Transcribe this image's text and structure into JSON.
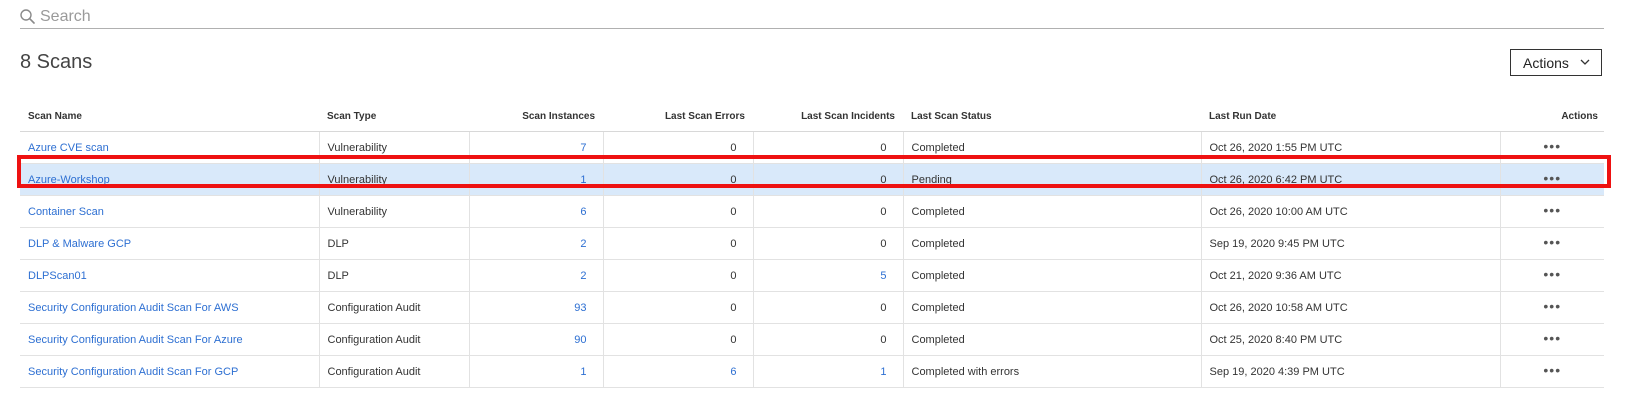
{
  "search": {
    "placeholder": "Search"
  },
  "header": {
    "count_title": "8 Scans",
    "actions_label": "Actions"
  },
  "table": {
    "columns": [
      "Scan Name",
      "Scan Type",
      "Scan Instances",
      "Last Scan Errors",
      "Last Scan Incidents",
      "Last Scan Status",
      "Last Run Date",
      "Actions"
    ],
    "rows": [
      {
        "name": "Azure CVE scan",
        "type": "Vulnerability",
        "instances": "7",
        "errors": "0",
        "incidents": "0",
        "status": "Completed",
        "date": "Oct 26, 2020 1:55 PM UTC",
        "selected": false
      },
      {
        "name": "Azure-Workshop",
        "type": "Vulnerability",
        "instances": "1",
        "errors": "0",
        "incidents": "0",
        "status": "Pending",
        "date": "Oct 26, 2020 6:42 PM UTC",
        "selected": true
      },
      {
        "name": "Container Scan",
        "type": "Vulnerability",
        "instances": "6",
        "errors": "0",
        "incidents": "0",
        "status": "Completed",
        "date": "Oct 26, 2020 10:00 AM UTC",
        "selected": false
      },
      {
        "name": "DLP & Malware GCP",
        "type": "DLP",
        "instances": "2",
        "errors": "0",
        "incidents": "0",
        "status": "Completed",
        "date": "Sep 19, 2020 9:45 PM UTC",
        "selected": false
      },
      {
        "name": "DLPScan01",
        "type": "DLP",
        "instances": "2",
        "errors": "0",
        "incidents": "5",
        "status": "Completed",
        "date": "Oct 21, 2020 9:36 AM UTC",
        "selected": false
      },
      {
        "name": "Security Configuration Audit Scan For AWS",
        "type": "Configuration Audit",
        "instances": "93",
        "errors": "0",
        "incidents": "0",
        "status": "Completed",
        "date": "Oct 26, 2020 10:58 AM UTC",
        "selected": false
      },
      {
        "name": "Security Configuration Audit Scan For Azure",
        "type": "Configuration Audit",
        "instances": "90",
        "errors": "0",
        "incidents": "0",
        "status": "Completed",
        "date": "Oct 25, 2020 8:40 PM UTC",
        "selected": false
      },
      {
        "name": "Security Configuration Audit Scan For GCP",
        "type": "Configuration Audit",
        "instances": "1",
        "errors": "6",
        "incidents": "1",
        "status": "Completed with errors",
        "date": "Sep 19, 2020 4:39 PM UTC",
        "selected": false
      }
    ],
    "row_action_icon": "more-horizontal-icon"
  },
  "colors": {
    "link": "#2d6fd2",
    "selected_row": "#d9e9fa",
    "highlight": "#ee1111"
  }
}
